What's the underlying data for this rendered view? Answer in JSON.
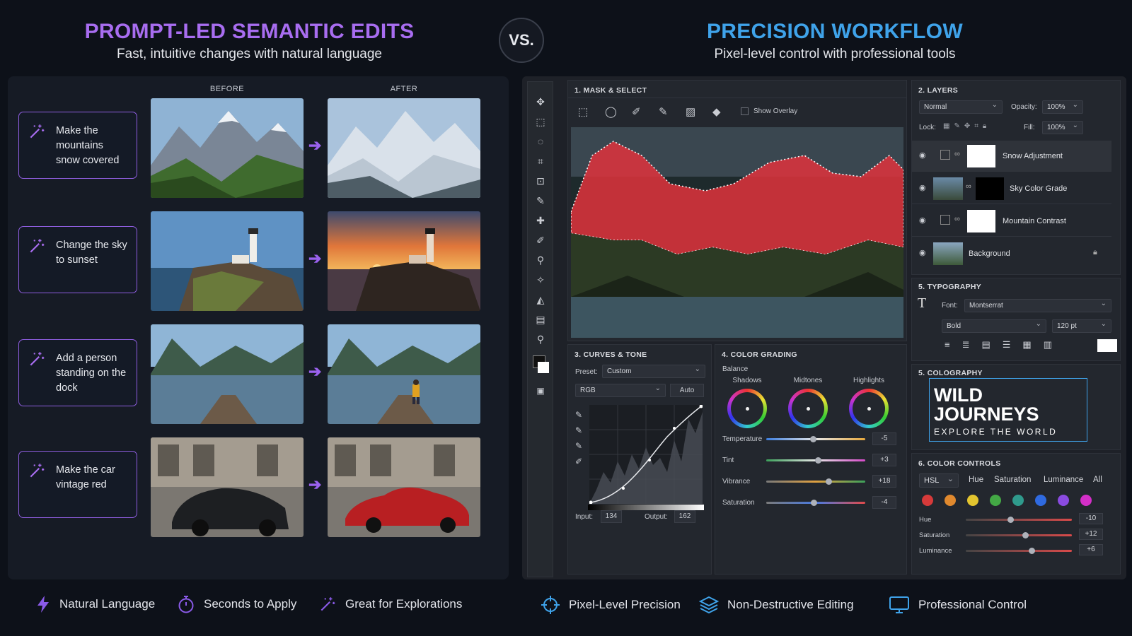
{
  "header": {
    "left_title": "PROMPT-LED SEMANTIC EDITS",
    "left_subtitle": "Fast, intuitive changes with natural language",
    "vs_label": "VS.",
    "right_title": "PRECISION WORKFLOW",
    "right_subtitle": "Pixel-level control with professional tools"
  },
  "comparison": {
    "before_label": "BEFORE",
    "after_label": "AFTER",
    "prompts": [
      "Make the mountains snow covered",
      "Change the sky to sunset",
      "Add a person standing on the dock",
      "Make the car vintage red"
    ]
  },
  "left_features": [
    "Natural Language",
    "Seconds to Apply",
    "Great for Explorations"
  ],
  "right_features": [
    "Pixel-Level Precision",
    "Non-Destructive Editing",
    "Professional Control"
  ],
  "mask_select": {
    "title": "1. MASK & SELECT",
    "show_overlay": "Show Overlay"
  },
  "layers": {
    "title": "2. LAYERS",
    "blend_mode": "Normal",
    "opacity_label": "Opacity:",
    "opacity_value": "100%",
    "lock_label": "Lock:",
    "fill_label": "Fill:",
    "fill_value": "100%",
    "items": [
      "Snow Adjustment",
      "Sky Color Grade",
      "Mountain Contrast",
      "Background"
    ]
  },
  "curves": {
    "title": "3. CURVES & TONE",
    "preset_label": "Preset:",
    "preset_value": "Custom",
    "channel": "RGB",
    "auto_label": "Auto",
    "input_label": "Input:",
    "input_value": "134",
    "output_label": "Output:",
    "output_value": "162"
  },
  "color_grading": {
    "title": "4. COLOR GRADING",
    "balance_label": "Balance",
    "wheels": [
      "Shadows",
      "Midtones",
      "Highlights"
    ],
    "sliders": [
      {
        "label": "Temperature",
        "value": "-5",
        "level": 0.47
      },
      {
        "label": "Tint",
        "value": "+3",
        "level": 0.52
      },
      {
        "label": "Vibrance",
        "value": "+18",
        "level": 0.63
      },
      {
        "label": "Saturation",
        "value": "-4",
        "level": 0.48
      }
    ]
  },
  "typography": {
    "title": "5. TYPOGRAPHY",
    "font_label": "Font:",
    "font_value": "Montserrat",
    "weight_value": "Bold",
    "size_value": "120 pt"
  },
  "colography": {
    "title": "5. COLOGRAPHY",
    "line1": "WILD",
    "line2": "JOURNEYS",
    "line3": "EXPLORE THE WORLD"
  },
  "color_controls": {
    "title": "6. COLOR CONTROLS",
    "mode": "HSL",
    "tabs": [
      "Hue",
      "Saturation",
      "Luminance",
      "All"
    ],
    "swatches": [
      "#d63a3a",
      "#e0892e",
      "#e3c52f",
      "#43a845",
      "#2f9a8c",
      "#2f6ae0",
      "#8a4be0",
      "#d42fc8"
    ],
    "sliders": [
      {
        "label": "Hue",
        "value": "-10",
        "level": 0.42
      },
      {
        "label": "Saturation",
        "value": "+12",
        "level": 0.56
      },
      {
        "label": "Luminance",
        "value": "+6",
        "level": 0.62
      }
    ]
  },
  "colors": {
    "purple": "#a86df0",
    "blue": "#3fa3ea",
    "mask_red": "#e0323c"
  }
}
